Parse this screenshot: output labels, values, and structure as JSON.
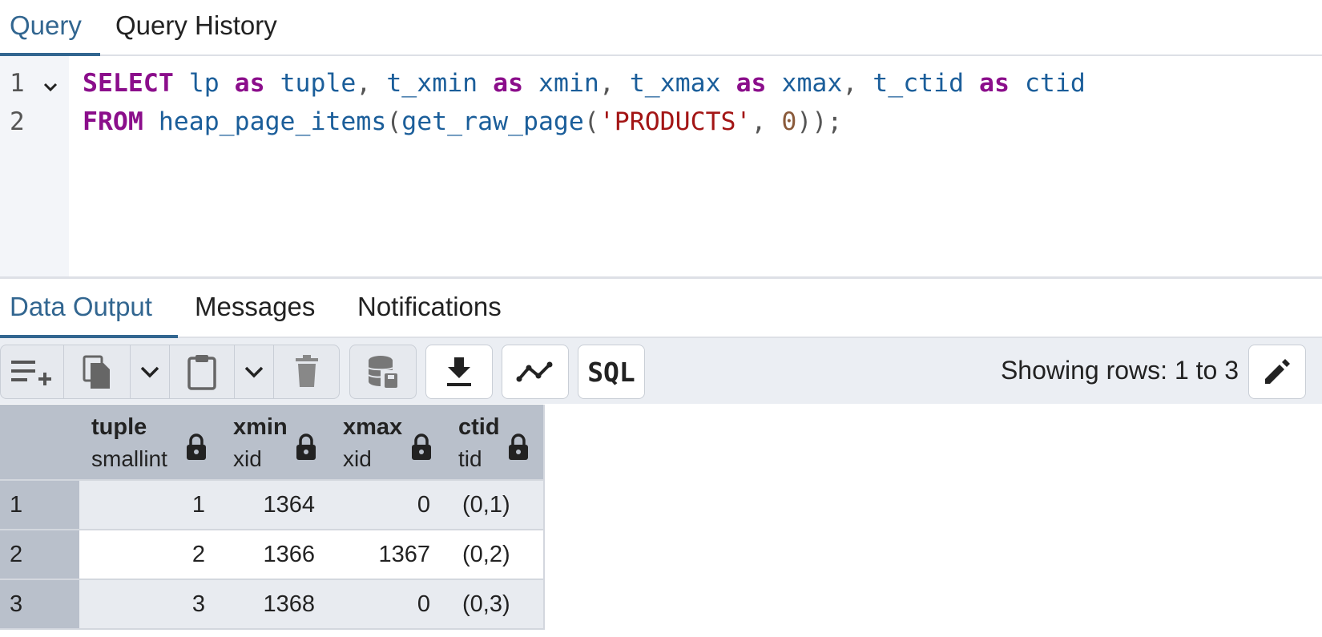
{
  "query_tabs": [
    {
      "label": "Query",
      "active": true
    },
    {
      "label": "Query History",
      "active": false
    }
  ],
  "editor": {
    "line_numbers": [
      "1",
      "2"
    ],
    "line1": [
      {
        "t": "SELECT",
        "c": "kw"
      },
      {
        "t": " ",
        "c": "punc"
      },
      {
        "t": "lp",
        "c": "id"
      },
      {
        "t": " ",
        "c": "punc"
      },
      {
        "t": "as",
        "c": "kw"
      },
      {
        "t": " ",
        "c": "punc"
      },
      {
        "t": "tuple",
        "c": "id"
      },
      {
        "t": ", ",
        "c": "punc"
      },
      {
        "t": "t_xmin",
        "c": "id"
      },
      {
        "t": " ",
        "c": "punc"
      },
      {
        "t": "as",
        "c": "kw"
      },
      {
        "t": " ",
        "c": "punc"
      },
      {
        "t": "xmin",
        "c": "id"
      },
      {
        "t": ", ",
        "c": "punc"
      },
      {
        "t": "t_xmax",
        "c": "id"
      },
      {
        "t": " ",
        "c": "punc"
      },
      {
        "t": "as",
        "c": "kw"
      },
      {
        "t": " ",
        "c": "punc"
      },
      {
        "t": "xmax",
        "c": "id"
      },
      {
        "t": ", ",
        "c": "punc"
      },
      {
        "t": "t_ctid",
        "c": "id"
      },
      {
        "t": " ",
        "c": "punc"
      },
      {
        "t": "as",
        "c": "kw"
      },
      {
        "t": " ",
        "c": "punc"
      },
      {
        "t": "ctid",
        "c": "id"
      }
    ],
    "line2": [
      {
        "t": "FROM",
        "c": "kw"
      },
      {
        "t": " ",
        "c": "punc"
      },
      {
        "t": "heap_page_items",
        "c": "id"
      },
      {
        "t": "(",
        "c": "punc"
      },
      {
        "t": "get_raw_page",
        "c": "id"
      },
      {
        "t": "(",
        "c": "punc"
      },
      {
        "t": "'PRODUCTS'",
        "c": "str"
      },
      {
        "t": ", ",
        "c": "punc"
      },
      {
        "t": "0",
        "c": "num"
      },
      {
        "t": "));",
        "c": "punc"
      }
    ]
  },
  "result_tabs": [
    {
      "label": "Data Output",
      "active": true
    },
    {
      "label": "Messages",
      "active": false
    },
    {
      "label": "Notifications",
      "active": false
    }
  ],
  "toolbar": {
    "icons": [
      "add-row-icon",
      "copy-icon",
      "chevron-down-icon",
      "paste-icon",
      "chevron-down-icon",
      "delete-icon",
      "save-data-icon",
      "download-icon",
      "graph-icon"
    ],
    "sql_label": "SQL",
    "rows_status": "Showing rows: 1 to 3",
    "edit_icon": "pencil-icon"
  },
  "grid": {
    "columns": [
      {
        "name": "tuple",
        "type": "smallint",
        "locked": true
      },
      {
        "name": "xmin",
        "type": "xid",
        "locked": true
      },
      {
        "name": "xmax",
        "type": "xid",
        "locked": true
      },
      {
        "name": "ctid",
        "type": "tid",
        "locked": true
      }
    ],
    "rows": [
      {
        "num": "1",
        "cells": [
          "1",
          "1364",
          "0",
          "(0,1)"
        ]
      },
      {
        "num": "2",
        "cells": [
          "2",
          "1366",
          "1367",
          "(0,2)"
        ]
      },
      {
        "num": "3",
        "cells": [
          "3",
          "1368",
          "0",
          "(0,3)"
        ]
      }
    ]
  },
  "colors": {
    "accent": "#326690",
    "keyword": "#8b0e8b",
    "identifier": "#1b5e9a",
    "string": "#a31515",
    "number": "#8a5a3a"
  }
}
